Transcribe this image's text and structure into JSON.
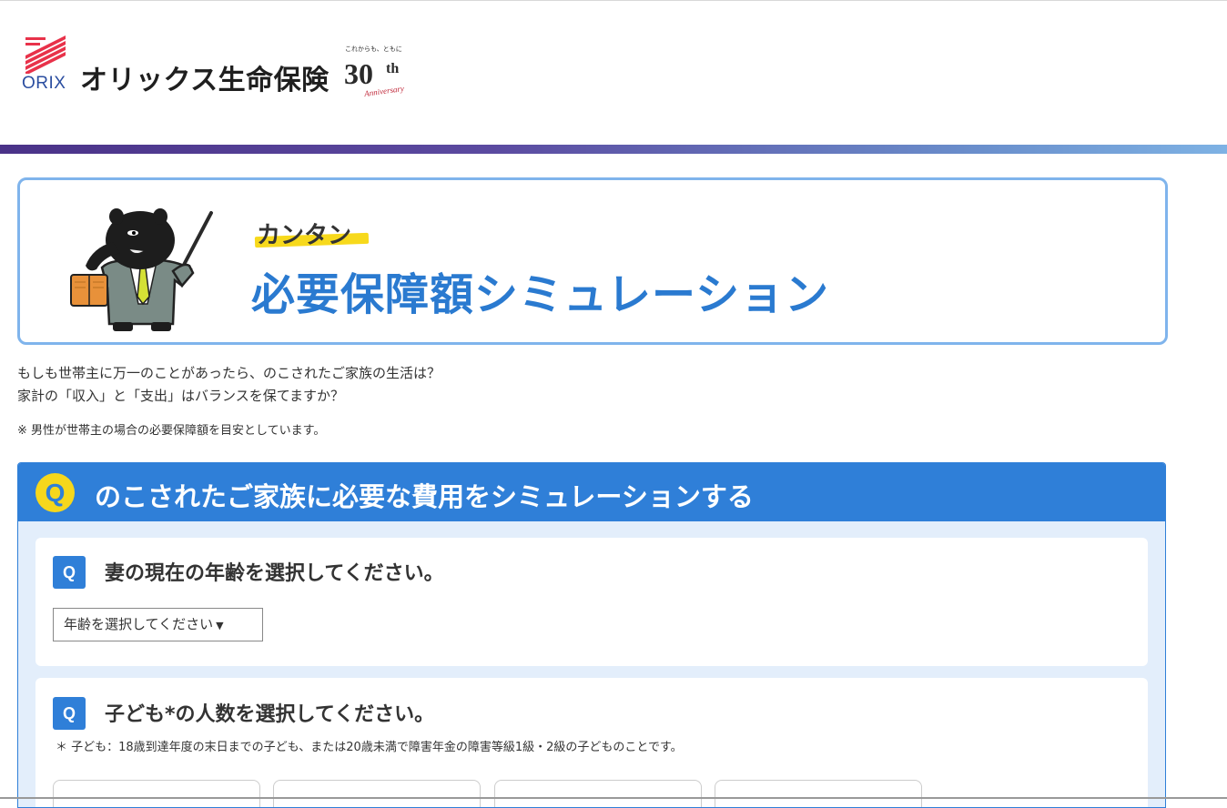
{
  "header": {
    "logo_word": "ORIX",
    "brand_name": "オリックス生命保険",
    "anniversary": {
      "tagline": "これからも、ともに",
      "number": "30",
      "suffix": "th",
      "sub": "Anniversary"
    }
  },
  "hero": {
    "kantan": "カンタン",
    "title": "必要保障額シミュレーション"
  },
  "intro": {
    "line1": "もしも世帯主に万一のことがあったら、のこされたご家族の生活は？",
    "line2": "家計の「収入」と「支出」はバランスを保てますか？",
    "note": "※ 男性が世帯主の場合の必要保障額を目安としています。"
  },
  "panel": {
    "badge": "Q",
    "title": "のこされたご家族に必要な費用をシミュレーションする",
    "questions": [
      {
        "badge": "Q",
        "text": "妻の現在の年齢を選択してください。",
        "select_value": "年齢を選択してください"
      },
      {
        "badge": "Q",
        "text": "子ども*の人数を選択してください。",
        "note": "＊ 子ども：18歳到達年度の末日までの子ども、または20歳未満で障害年金の障害等級1級・2級の子どものことです。"
      }
    ]
  },
  "colors": {
    "brand_blue": "#2f7fd8",
    "accent_yellow": "#f6d71c",
    "panel_bg": "#e3eefb",
    "hero_border": "#7fb4ec"
  },
  "icons": [
    "orix-logo-icon",
    "anniversary-logo-icon",
    "tapir-teacher-mascot-icon",
    "chevron-down-icon"
  ]
}
